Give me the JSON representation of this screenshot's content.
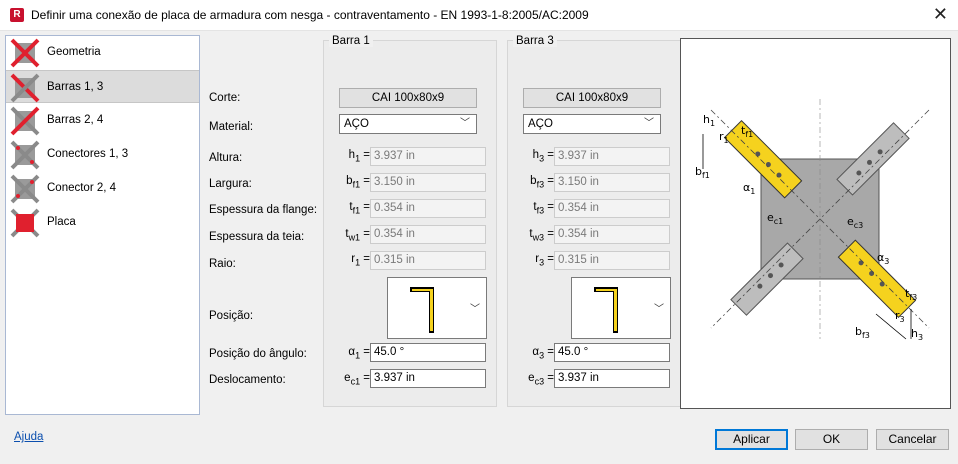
{
  "window": {
    "app_icon": "R",
    "title": "Definir uma conexão de placa de armadura com nesga - contraventamento  - EN 1993-1-8:2005/AC:2009",
    "close": "✕"
  },
  "sidebar": {
    "items": [
      {
        "label": "Geometria"
      },
      {
        "label": "Barras 1, 3"
      },
      {
        "label": "Barras 2, 4"
      },
      {
        "label": "Conectores 1, 3"
      },
      {
        "label": "Conector 2, 4"
      },
      {
        "label": "Placa"
      }
    ]
  },
  "labels": {
    "section": "Corte:",
    "material": "Material:",
    "height": "Altura:",
    "width": "Largura:",
    "flange": "Espessura da flange:",
    "web": "Espessura da teia:",
    "radius": "Raio:",
    "position": "Posição:",
    "angle": "Posição do ângulo:",
    "offset": "Deslocamento:"
  },
  "bar1": {
    "title": "Barra 1",
    "section": "CAI 100x80x9",
    "material": "AÇO",
    "h_sym": "h",
    "h_sub": "1",
    "h_val": "3.937 in",
    "b_sym": "b",
    "b_sub": "f1",
    "b_val": "3.150 in",
    "tf_sym": "t",
    "tf_sub": "f1",
    "tf_val": "0.354 in",
    "tw_sym": "t",
    "tw_sub": "w1",
    "tw_val": "0.354 in",
    "r_sym": "r",
    "r_sub": "1",
    "r_val": "0.315 in",
    "a_sym": "α",
    "a_sub": "1",
    "a_val": "45.0 °",
    "e_sym": "e",
    "e_sub": "c1",
    "e_val": "3.937 in"
  },
  "bar3": {
    "title": "Barra 3",
    "section": "CAI 100x80x9",
    "material": "AÇO",
    "h_sym": "h",
    "h_sub": "3",
    "h_val": "3.937 in",
    "b_sym": "b",
    "b_sub": "f3",
    "b_val": "3.150 in",
    "tf_sym": "t",
    "tf_sub": "f3",
    "tf_val": "0.354 in",
    "tw_sym": "t",
    "tw_sub": "w3",
    "tw_val": "0.354 in",
    "r_sym": "r",
    "r_sub": "3",
    "r_val": "0.315 in",
    "a_sym": "α",
    "a_sub": "3",
    "a_val": "45.0 °",
    "e_sym": "e",
    "e_sub": "c3",
    "e_val": "3.937 in"
  },
  "preview_labels": {
    "h1": "h",
    "h1s": "1",
    "r1": "r",
    "r1s": "1",
    "tf1": "t",
    "tf1s": "f1",
    "bf1": "b",
    "bf1s": "f1",
    "a1": "α",
    "a1s": "1",
    "ec1": "e",
    "ec1s": "c1",
    "ec3": "e",
    "ec3s": "c3",
    "a3": "α",
    "a3s": "3",
    "tf3": "t",
    "tf3s": "f3",
    "r3": "r",
    "r3s": "3",
    "bf3": "b",
    "bf3s": "f3",
    "h3": "h",
    "h3s": "3"
  },
  "footer": {
    "help": "Ajuda",
    "apply": "Aplicar",
    "ok": "OK",
    "cancel": "Cancelar"
  },
  "colors": {
    "accent": "#0078d7",
    "member": "#f5d21e",
    "icon_red": "#e0202e"
  }
}
